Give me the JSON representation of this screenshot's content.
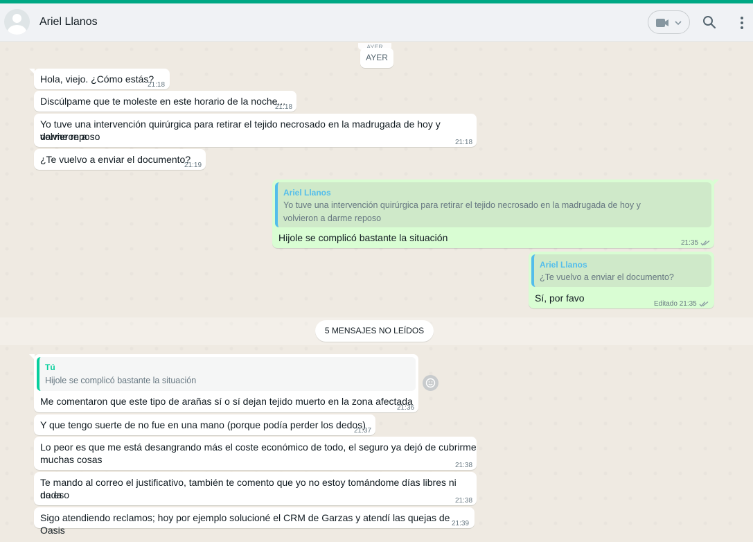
{
  "header": {
    "contact_name": "Ariel Llanos",
    "icons": [
      "avatar",
      "video-call-icon",
      "chevron-down-icon",
      "search-icon",
      "menu-icon"
    ]
  },
  "chat": {
    "date_ghost": "AYER",
    "date_separator": "AYER",
    "unread_divider": "5 MENSAJES NO LEÍDOS",
    "messages": [
      {
        "direction": "in",
        "text": "Hola, viejo. ¿Cómo estás?",
        "time": "21:18"
      },
      {
        "direction": "in",
        "text": "Discúlpame que te moleste en este horario de la noche...",
        "time": "21:18"
      },
      {
        "direction": "in",
        "text_line1": "Yo tuve una intervención quirúrgica para retirar el tejido necrosado en la madrugada de hoy y volvieron a",
        "text_line2": "darme reposo",
        "time": "21:18"
      },
      {
        "direction": "in",
        "text": "¿Te vuelvo a enviar el documento?",
        "time": "21:19"
      },
      {
        "direction": "out",
        "quote_author": "Ariel Llanos",
        "quote_line1": "Yo tuve una intervención quirúrgica para retirar el tejido necrosado en la madrugada de hoy y",
        "quote_line2": "volvieron a darme reposo",
        "text": "Hijole se complicó bastante la situación",
        "time": "21:35",
        "status": "read"
      },
      {
        "direction": "out",
        "quote_author": "Ariel Llanos",
        "quote_text": "¿Te vuelvo a enviar el documento?",
        "text": "Sí, por favo",
        "edited_label": "Editado",
        "time": "21:35",
        "status": "read"
      },
      {
        "direction": "in",
        "quote_author": "Tú",
        "quote_text": "Hijole se complicó bastante la situación",
        "text": "Me comentaron que este tipo de arañas sí o sí dejan tejido muerto en la zona afectada",
        "time": "21:36"
      },
      {
        "direction": "in",
        "text": "Y que tengo suerte de no fue en una mano (porque podía perder los dedos)",
        "time": "21:37"
      },
      {
        "direction": "in",
        "text_line1": "Lo peor es que me está desangrando más el coste económico de todo, el seguro ya dejó de cubrirme",
        "text_line2": "muchas cosas",
        "time": "21:38"
      },
      {
        "direction": "in",
        "text_line1": "Te mando al correo el justificativo, también te comento que yo no estoy tomándome días libres ni nada",
        "text_line2": "de eso",
        "time": "21:38"
      },
      {
        "direction": "in",
        "text": "Sigo atendiendo reclamos; hoy por ejemplo solucioné el CRM de Garzas y atendí las quejas de Oasis",
        "time": "21:39"
      }
    ]
  },
  "colors": {
    "accent": "#00a884",
    "outgoing_bubble": "#d9fdd3",
    "incoming_bubble": "#ffffff",
    "quote_bar_blue": "#53bdeb",
    "quote_bar_green": "#06cf9c",
    "chat_background": "#efeae2"
  }
}
